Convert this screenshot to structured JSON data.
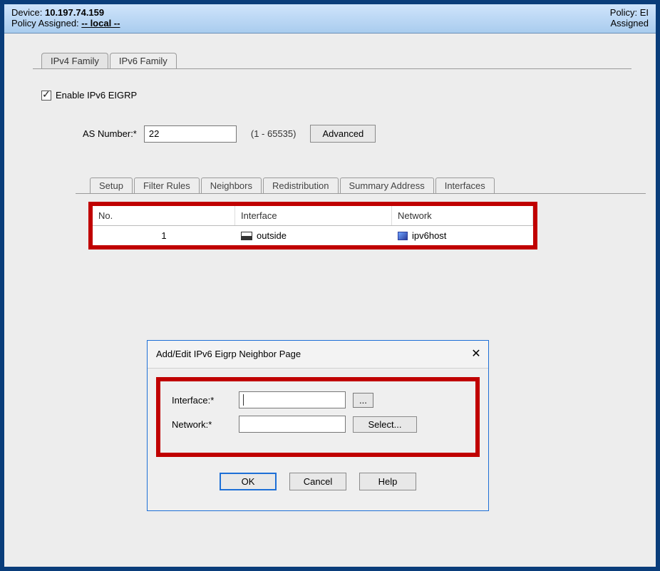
{
  "header": {
    "device_label": "Device:",
    "device_ip": "10.197.74.159",
    "policy_assigned_label": "Policy Assigned:",
    "policy_assigned_value": "-- local --",
    "right_policy_label": "Policy:",
    "right_policy_value": "EI",
    "right_assigned_label": "Assigned"
  },
  "top_tabs": {
    "ipv4": "IPv4 Family",
    "ipv6": "IPv6 Family",
    "active": "ipv6"
  },
  "enable_checkbox": {
    "checked": true,
    "label": "Enable IPv6 EIGRP"
  },
  "as_row": {
    "label": "AS Number:*",
    "value": "22",
    "range": "(1 - 65535)",
    "advanced_btn": "Advanced"
  },
  "sub_tabs": {
    "items": [
      "Setup",
      "Filter Rules",
      "Neighbors",
      "Redistribution",
      "Summary Address",
      "Interfaces"
    ],
    "active_index": 2
  },
  "neighbors_table": {
    "headers": {
      "no": "No.",
      "interface": "Interface",
      "network": "Network"
    },
    "rows": [
      {
        "no": "1",
        "interface": "outside",
        "network": "ipv6host"
      }
    ]
  },
  "dialog": {
    "title": "Add/Edit IPv6 Eigrp Neighbor Page",
    "close_glyph": "✕",
    "fields": {
      "interface_label": "Interface:*",
      "interface_value": "",
      "browse_btn": "...",
      "network_label": "Network:*",
      "network_value": "",
      "select_btn": "Select..."
    },
    "buttons": {
      "ok": "OK",
      "cancel": "Cancel",
      "help": "Help"
    }
  }
}
